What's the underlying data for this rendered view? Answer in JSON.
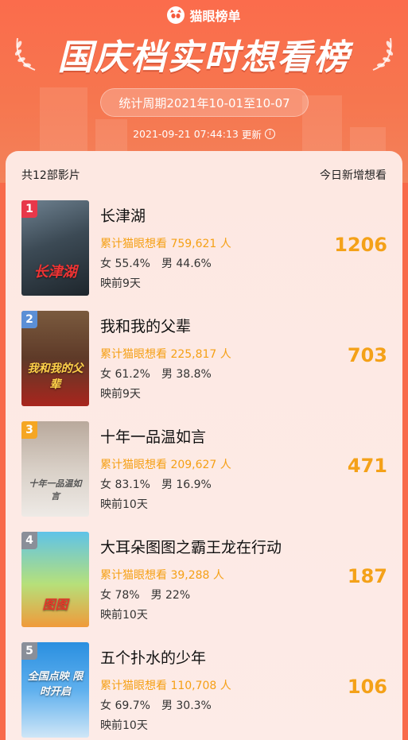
{
  "brand": {
    "name": "猫眼榜单",
    "logo_icon": "cat-eye-logo-icon"
  },
  "title": "国庆档实时想看榜",
  "period": "统计周期2021年10-01至10-07",
  "updated": {
    "time": "2021-09-21 07:44:13",
    "label": "更新",
    "icon": "info-icon"
  },
  "list": {
    "count_label": "共12部影片",
    "right_label": "今日新增想看",
    "items": [
      {
        "rank": "1",
        "rank_color": "#e8384a",
        "title": "长津湖",
        "poster_text": "长津湖",
        "cumulative": "累计猫眼想看 759,621 人",
        "female": "女 55.4%",
        "male": "男 44.6%",
        "days": "映前9天",
        "new_wants": "1206"
      },
      {
        "rank": "2",
        "rank_color": "#5b8fd6",
        "title": "我和我的父辈",
        "poster_text": "我和我的父辈",
        "cumulative": "累计猫眼想看 225,817 人",
        "female": "女 61.2%",
        "male": "男 38.8%",
        "days": "映前9天",
        "new_wants": "703"
      },
      {
        "rank": "3",
        "rank_color": "#f5a623",
        "title": "十年一品温如言",
        "poster_text": "十年一品温如言",
        "cumulative": "累计猫眼想看 209,627 人",
        "female": "女 83.1%",
        "male": "男 16.9%",
        "days": "映前10天",
        "new_wants": "471"
      },
      {
        "rank": "4",
        "rank_color": "#8a8f99",
        "title": "大耳朵图图之霸王龙在行动",
        "poster_text": "图图",
        "cumulative": "累计猫眼想看 39,288 人",
        "female": "女 78%",
        "male": "男 22%",
        "days": "映前10天",
        "new_wants": "187"
      },
      {
        "rank": "5",
        "rank_color": "#8a8f99",
        "title": "五个扑水的少年",
        "poster_text": "全国点映 限时开启",
        "cumulative": "累计猫眼想看 110,708 人",
        "female": "女 69.7%",
        "male": "男 30.3%",
        "days": "映前10天",
        "new_wants": "106"
      }
    ]
  }
}
